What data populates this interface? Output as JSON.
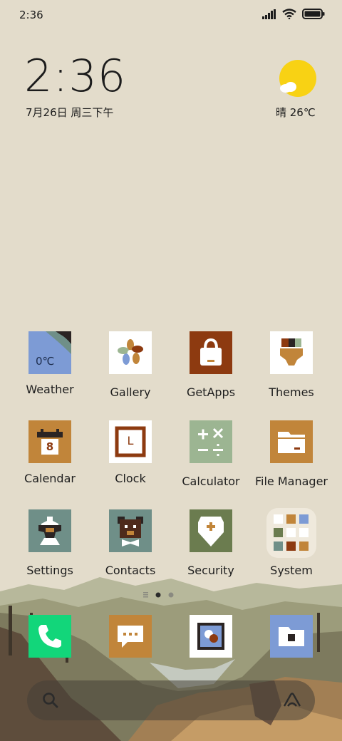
{
  "status_bar": {
    "time": "2:36"
  },
  "clock_widget": {
    "time": "2:36",
    "date": "7月26日 周三下午"
  },
  "weather_widget": {
    "condition_temp": "晴 26℃"
  },
  "apps": [
    {
      "label": "Weather",
      "icon": "weather-icon",
      "badge": "0℃"
    },
    {
      "label": "Gallery",
      "icon": "gallery-icon"
    },
    {
      "label": "GetApps",
      "icon": "getapps-icon"
    },
    {
      "label": "Themes",
      "icon": "themes-icon"
    },
    {
      "label": "Calendar",
      "icon": "calendar-icon",
      "badge": "8"
    },
    {
      "label": "Clock",
      "icon": "clock-icon",
      "badge": "L"
    },
    {
      "label": "Calculator",
      "icon": "calculator-icon"
    },
    {
      "label": "File Manager",
      "icon": "file-manager-icon"
    },
    {
      "label": "Settings",
      "icon": "settings-icon"
    },
    {
      "label": "Contacts",
      "icon": "contacts-icon"
    },
    {
      "label": "Security",
      "icon": "security-icon"
    },
    {
      "label": "System",
      "icon": "folder-icon"
    }
  ],
  "dock": [
    {
      "icon": "phone-icon"
    },
    {
      "icon": "messages-icon"
    },
    {
      "icon": "camera-icon"
    },
    {
      "icon": "browser-icon"
    }
  ],
  "colors": {
    "background": "#e3dccb",
    "sun": "#f8d214",
    "brown": "#8d3a10",
    "ochre": "#c1853a",
    "sage": "#9cb592",
    "teal_gray": "#6f8f88",
    "olive": "#6b7c4f",
    "blue": "#7d9bd5",
    "green": "#12d67a"
  }
}
